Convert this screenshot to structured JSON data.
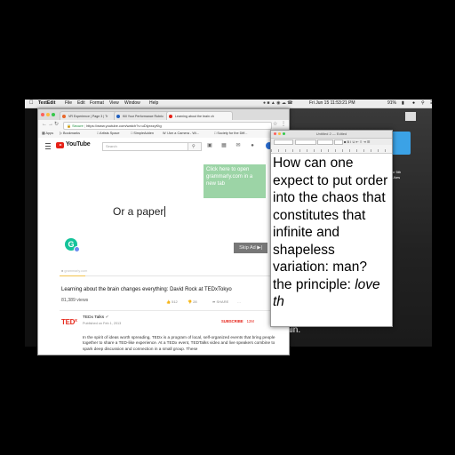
{
  "menubar": {
    "apple": "",
    "app": "TextEdit",
    "items": [
      "File",
      "Edit",
      "Format",
      "View",
      "Window",
      "Help"
    ],
    "clock": "Fri Jun 15  11:53:21 PM",
    "battery": "91%"
  },
  "browser": {
    "tabs": [
      {
        "label": "VR Experience | Page 3 | Tr"
      },
      {
        "label": "Kill Your Performance Rubric"
      },
      {
        "label": "Learning about the brain ch"
      }
    ],
    "url_secure": "Secure",
    "url": "https://www.youtube.com/watch?v=uDlyxxzyKtg",
    "bookmarks": [
      "Apps",
      "Bookmarks",
      "Artists Space",
      "SimpleAdden",
      "I Am a Camera - Wi...",
      "Society for the Diff..."
    ]
  },
  "youtube": {
    "logo_text": "YouTube",
    "search_placeholder": "Search",
    "grammarly_note": "Click here to open grammarly.com in a new tab",
    "overlay_text": "Or a paper",
    "grammarly_url": "grammarly.com",
    "skip_label": "Skip Ad",
    "progress": 0.12,
    "video_title": "Learning about the brain changes everything: David Rock at TEDxTokyo",
    "views": "81,389 views",
    "likes": "512",
    "dislikes": "28",
    "share": "SHARE",
    "more": "…",
    "channel_logo": "TED",
    "channel_logo_sup": "x",
    "channel": "TEDx Talks",
    "published": "Published on Feb 1, 2013",
    "subscribe": "SUBSCRIBE",
    "subscribers": "12M",
    "description": "In the spirit of ideas worth spreading, TEDx is a program of local, self-organized events that bring people together to share a TED-like experience. At a TEDx event, TEDTalks video and live speakers combine to spark deep discussion and connection in a small group. These"
  },
  "textedit": {
    "title": "Untitled 2 — Edited",
    "body_plain": "How can one expect to put order into the chaos that constitutes that infinite and shapeless variation: man? the principle: ",
    "body_italic": "love th"
  },
  "background": {
    "fragment_1": "ain.",
    "fragment_2": "or 5th",
    "fragment_3": "Ukes"
  },
  "colors": {
    "youtube_red": "#e62117",
    "grammarly_green": "#15c39a",
    "ted_red": "#e62b1e"
  }
}
